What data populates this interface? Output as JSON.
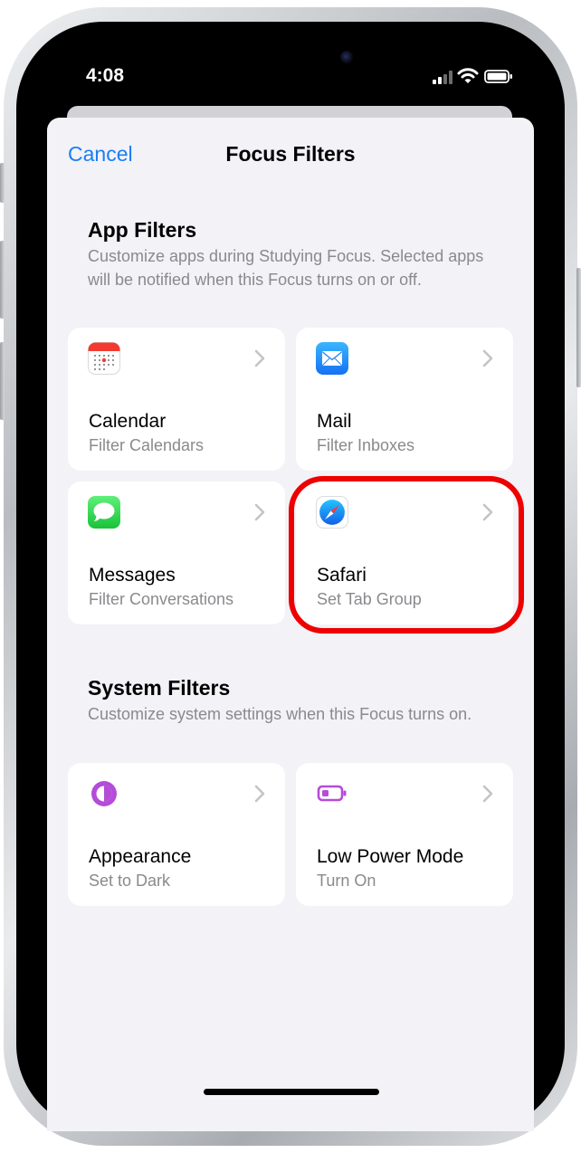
{
  "status_bar": {
    "time": "4:08"
  },
  "nav": {
    "cancel_label": "Cancel",
    "title": "Focus Filters"
  },
  "app_filters": {
    "title": "App Filters",
    "description": "Customize apps during Studying  Focus. Selected apps will be notified when this Focus turns on or off.",
    "items": [
      {
        "name": "Calendar",
        "subtitle": "Filter Calendars",
        "icon": "calendar-icon"
      },
      {
        "name": "Mail",
        "subtitle": "Filter Inboxes",
        "icon": "mail-icon"
      },
      {
        "name": "Messages",
        "subtitle": "Filter Conversations",
        "icon": "messages-icon"
      },
      {
        "name": "Safari",
        "subtitle": "Set Tab Group",
        "icon": "safari-icon"
      }
    ]
  },
  "system_filters": {
    "title": "System Filters",
    "description": "Customize system settings when this Focus turns on.",
    "items": [
      {
        "name": "Appearance",
        "subtitle": "Set to Dark",
        "icon": "appearance-icon"
      },
      {
        "name": "Low Power Mode",
        "subtitle": "Turn On",
        "icon": "battery-icon"
      }
    ]
  },
  "colors": {
    "accent": "#1a7ef5",
    "highlight": "#ee0000",
    "background": "#f2f2f7",
    "secondary_text": "#8a8a8e",
    "system_icon": "#b44cd9"
  }
}
